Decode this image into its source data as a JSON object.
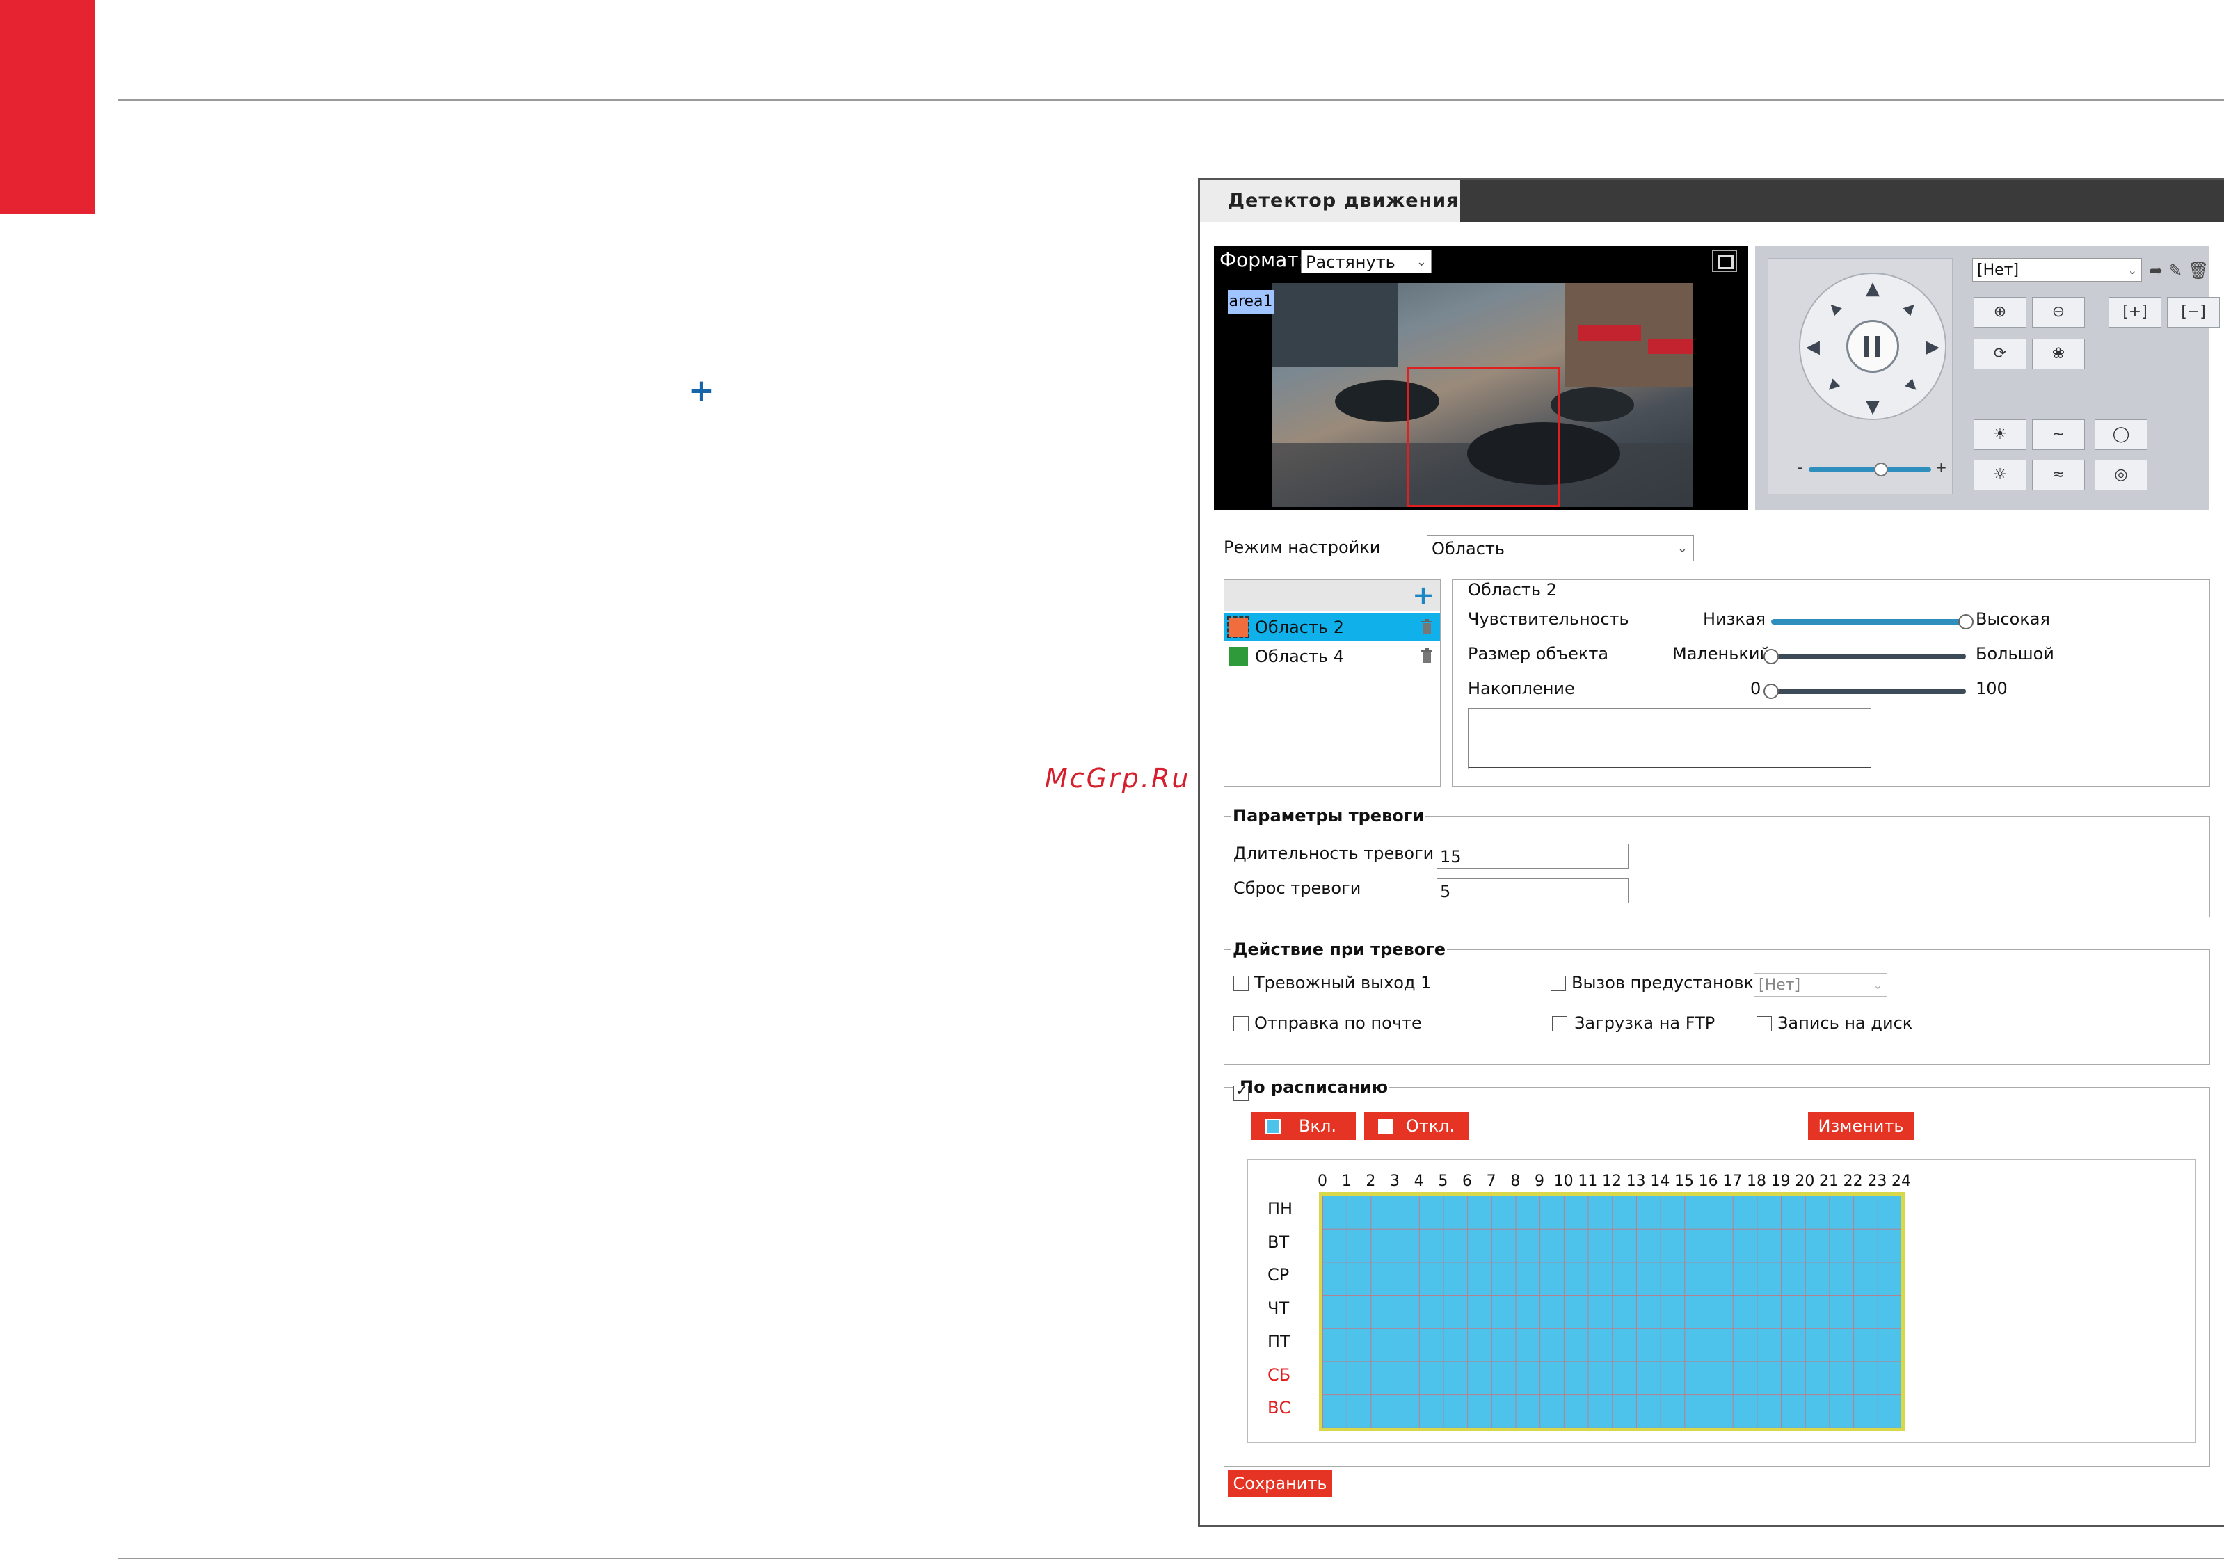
{
  "watermark": "McGrp.Ru",
  "page_plus_glyph": "+",
  "panel": {
    "tab_title": "Детектор движения",
    "video": {
      "format_label": "Формат:",
      "format_value": "Растянуть",
      "area_tag": "area1"
    },
    "ptz": {
      "preset_value": "[Нет]",
      "zoom_minus": "-",
      "zoom_plus": "+"
    },
    "mode": {
      "label": "Режим настройки",
      "value": "Область"
    },
    "areas": [
      {
        "name": "Область 2",
        "color": "#f26d3d",
        "selected": true
      },
      {
        "name": "Область 4",
        "color": "#2e9a3a",
        "selected": false
      }
    ],
    "area_detail": {
      "title": "Область 2",
      "sensitivity": {
        "label": "Чувствительность",
        "min_label": "Низкая",
        "max_label": "Высокая",
        "level": 1.0
      },
      "object_size": {
        "label": "Размер объекта",
        "min_label": "Маленький",
        "max_label": "Большой",
        "level": 0.0
      },
      "accumulation": {
        "label": "Накопление",
        "min_label": "0",
        "max_label": "100",
        "level": 0.0
      }
    },
    "alarm_params": {
      "legend": "Параметры тревоги",
      "duration_label": "Длительность тревоги",
      "duration_value": "15",
      "reset_label": "Сброс тревоги",
      "reset_value": "5"
    },
    "alarm_action": {
      "legend": "Действие при тревоге",
      "alarm_out": "Тревожный выход 1",
      "preset_call": "Вызов предустановки",
      "preset_select": "[Нет]",
      "email": "Отправка по почте",
      "ftp": "Загрузка на FTP",
      "record": "Запись на диск"
    },
    "schedule": {
      "legend": "По расписанию",
      "enabled": true,
      "on_label": "Вкл.",
      "off_label": "Откл.",
      "edit_label": "Изменить",
      "hours": [
        "0",
        "1",
        "2",
        "3",
        "4",
        "5",
        "6",
        "7",
        "8",
        "9",
        "10",
        "11",
        "12",
        "13",
        "14",
        "15",
        "16",
        "17",
        "18",
        "19",
        "20",
        "21",
        "22",
        "23",
        "24"
      ],
      "days": [
        "ПН",
        "ВТ",
        "СР",
        "ЧТ",
        "ПТ",
        "СБ",
        "ВС"
      ],
      "weekend_color": "#e02020",
      "active_color": "#4dc3ec"
    },
    "save_label": "Сохранить"
  }
}
